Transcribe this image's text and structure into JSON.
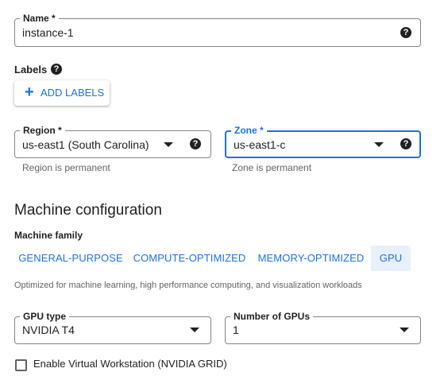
{
  "name_field": {
    "label": "Name *",
    "value": "instance-1"
  },
  "labels": {
    "heading": "Labels",
    "add_button": "ADD LABELS"
  },
  "region_field": {
    "label": "Region *",
    "value": "us-east1 (South Carolina)",
    "hint": "Region is permanent"
  },
  "zone_field": {
    "label": "Zone *",
    "value": "us-east1-c",
    "hint": "Zone is permanent"
  },
  "machine": {
    "heading": "Machine configuration",
    "family_label": "Machine family",
    "tabs": [
      "GENERAL-PURPOSE",
      "COMPUTE-OPTIMIZED",
      "MEMORY-OPTIMIZED",
      "GPU"
    ],
    "description": "Optimized for machine learning, high performance computing, and visualization workloads"
  },
  "gpu_type_field": {
    "label": "GPU type",
    "value": "NVIDIA T4"
  },
  "num_gpus_field": {
    "label": "Number of GPUs",
    "value": "1"
  },
  "virtual_ws": {
    "label": "Enable Virtual Workstation (NVIDIA GRID)"
  },
  "icons": {
    "help": "?",
    "plus": "+"
  },
  "colors": {
    "accent": "#1a73e8",
    "active_tab_bg": "#e8f0fe"
  }
}
